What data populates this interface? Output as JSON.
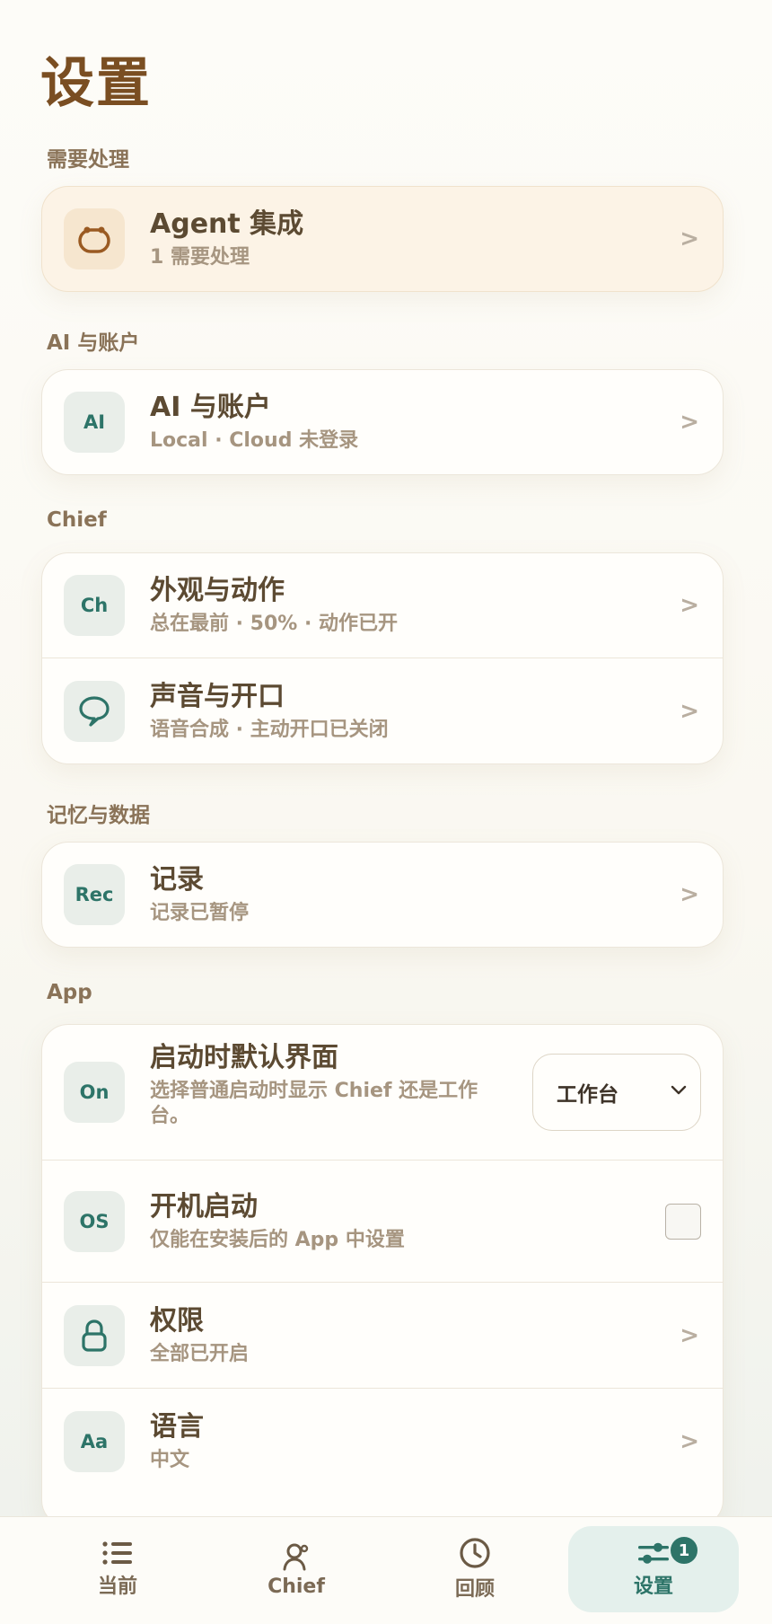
{
  "page_title": "设置",
  "sections": {
    "attention": {
      "label": "需要处理",
      "agent": {
        "title": "Agent 集成",
        "subtitle": "1 需要处理"
      }
    },
    "ai": {
      "label": "AI 与账户",
      "account": {
        "tile": "AI",
        "title": "AI 与账户",
        "subtitle": "Local · Cloud 未登录"
      }
    },
    "chief": {
      "label": "Chief",
      "appearance": {
        "tile": "Ch",
        "title": "外观与动作",
        "subtitle": "总在最前 · 50% · 动作已开"
      },
      "voice": {
        "title": "声音与开口",
        "subtitle": "语音合成 · 主动开口已关闭"
      }
    },
    "memory": {
      "label": "记忆与数据",
      "records": {
        "tile": "Rec",
        "title": "记录",
        "subtitle": "记录已暂停"
      }
    },
    "app": {
      "label": "App",
      "startup_view": {
        "tile": "On",
        "title": "启动时默认界面",
        "subtitle": "选择普通启动时显示 Chief 还是工作台。",
        "selected": "工作台"
      },
      "launch_at_login": {
        "tile": "OS",
        "title": "开机启动",
        "subtitle": "仅能在安装后的 App 中设置",
        "checked": false
      },
      "permissions": {
        "title": "权限",
        "subtitle": "全部已开启"
      },
      "language": {
        "tile": "Aa",
        "title": "语言",
        "subtitle": "中文"
      }
    }
  },
  "chevron": ">",
  "tabs": [
    {
      "label": "当前",
      "icon": "list-icon"
    },
    {
      "label": "Chief",
      "icon": "person-icon"
    },
    {
      "label": "回顾",
      "icon": "clock-icon"
    },
    {
      "label": "设置",
      "icon": "sliders-icon",
      "badge": "1",
      "active": true
    }
  ],
  "colors": {
    "accent": "#2d7468",
    "title": "#7a4e22",
    "alert_bg": "#fcf3e6"
  }
}
